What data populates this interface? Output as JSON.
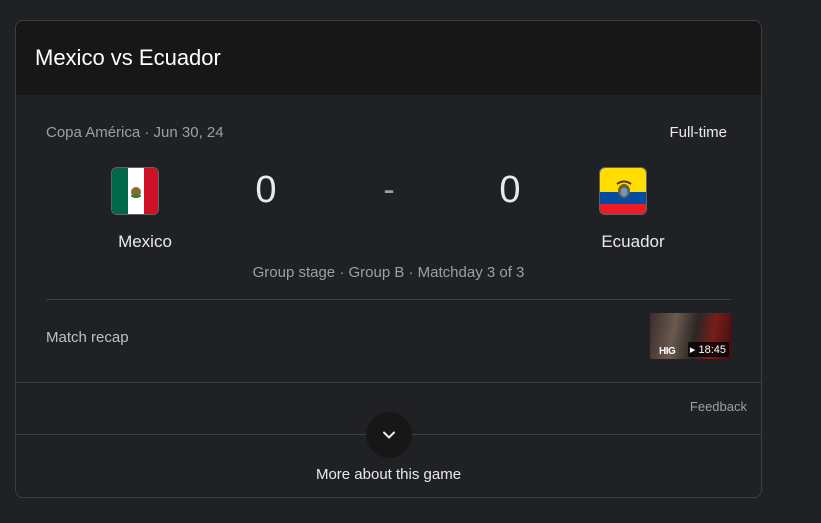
{
  "card": {
    "title": "Mexico vs Ecuador"
  },
  "match": {
    "competition_date": "Copa América · Jun 30, 24",
    "status": "Full-time",
    "home": {
      "name": "Mexico",
      "score": "0",
      "flag_icon": "mexico-flag-icon"
    },
    "away": {
      "name": "Ecuador",
      "score": "0",
      "flag_icon": "ecuador-flag-icon"
    },
    "separator": "-",
    "stage": "Group stage · Group B · Matchday 3 of 3"
  },
  "recap": {
    "label": "Match recap",
    "thumbnail_text": "HIG",
    "duration": "▸ 18:45"
  },
  "footer": {
    "feedback": "Feedback",
    "expand_icon": "chevron-down-icon",
    "more_label": "More about this game"
  },
  "colors": {
    "background": "#202124",
    "header": "#171717",
    "text_primary": "#e8eaed",
    "text_secondary": "#9aa0a6",
    "divider": "#3c4043"
  }
}
